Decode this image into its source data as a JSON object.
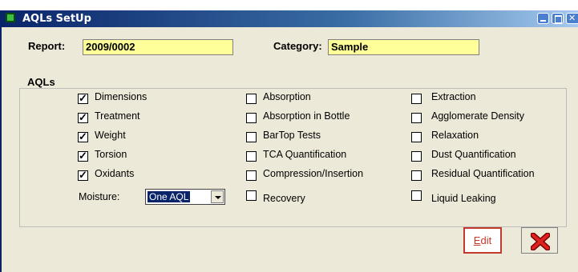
{
  "window": {
    "title": "AQLs SetUp"
  },
  "header": {
    "report_label": "Report:",
    "report_value": "2009/0002",
    "category_label": "Category:",
    "category_value": "Sample"
  },
  "aqls": {
    "group_title": "AQLs",
    "col1": [
      {
        "label": "Dimensions",
        "checked": true
      },
      {
        "label": "Treatment",
        "checked": true
      },
      {
        "label": "Weight",
        "checked": true
      },
      {
        "label": "Torsion",
        "checked": true
      },
      {
        "label": "Oxidants",
        "checked": true
      }
    ],
    "moisture_label": "Moisture:",
    "moisture_value": "One AQL",
    "col2": [
      {
        "label": "Absorption",
        "checked": false
      },
      {
        "label": "Absorption in Bottle",
        "checked": false
      },
      {
        "label": "BarTop Tests",
        "checked": false
      },
      {
        "label": "TCA Quantification",
        "checked": false
      },
      {
        "label": "Compression/Insertion",
        "checked": false
      },
      {
        "label": "Recovery",
        "checked": false
      }
    ],
    "col3": [
      {
        "label": "Extraction",
        "checked": false
      },
      {
        "label": "Agglomerate Density",
        "checked": false
      },
      {
        "label": "Relaxation",
        "checked": false
      },
      {
        "label": "Dust Quantification",
        "checked": false
      },
      {
        "label": "Residual Quantification",
        "checked": false
      },
      {
        "label": "Liquid Leaking",
        "checked": false
      }
    ]
  },
  "actions": {
    "edit_mnemonic": "E",
    "edit_rest": "dit"
  },
  "colors": {
    "field_bg": "#ffff99",
    "title_bar": "#0a246a",
    "window_bg": "#ece9d8",
    "edit_accent": "#c0392b"
  }
}
